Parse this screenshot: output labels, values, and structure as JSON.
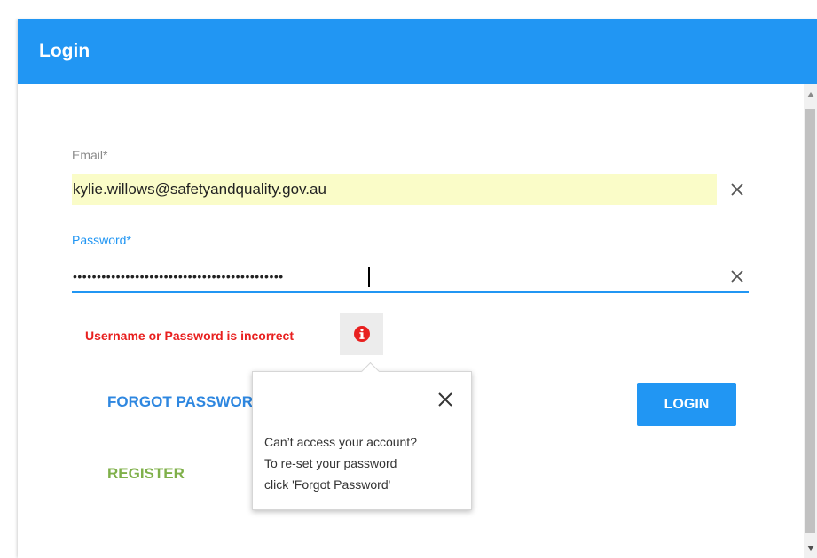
{
  "dialog": {
    "title": "Login"
  },
  "form": {
    "email_label": "Email*",
    "email_value": "kylie.willows@safetyandquality.gov.au",
    "password_label": "Password*",
    "password_masked": "••••••••••••••••••••••••••••••••••••••••••••"
  },
  "error": {
    "message": "Username or Password is incorrect"
  },
  "actions": {
    "forgot_password_label": "FORGOT PASSWORD",
    "register_label": "REGISTER",
    "login_label": "LOGIN"
  },
  "popover": {
    "lines": [
      "Can’t access your account?",
      "To re-set your password",
      "click 'Forgot Password'"
    ]
  },
  "icons": {
    "clear": "close-icon",
    "info": "info-icon",
    "scroll_up": "arrow-up-icon",
    "scroll_down": "arrow-down-icon"
  },
  "colors": {
    "primary": "#2196f3",
    "error": "#e8201f",
    "register": "#7fb04a",
    "autofill": "#fafcc8"
  }
}
